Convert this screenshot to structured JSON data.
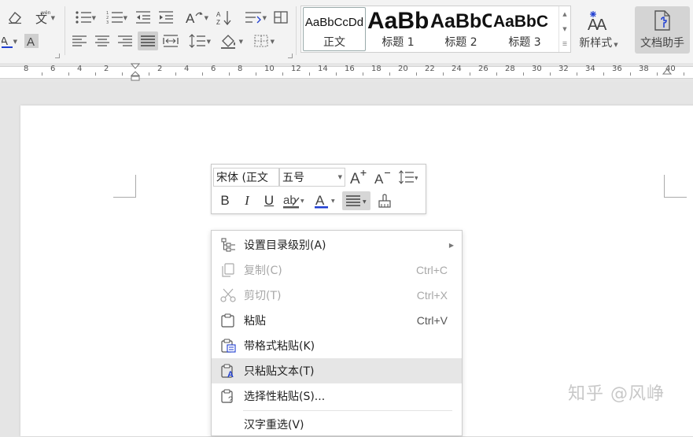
{
  "ribbon": {
    "styles": [
      {
        "sample": "AaBbCcDd",
        "name": "正文"
      },
      {
        "sample": "AaBb",
        "name": "标题 1"
      },
      {
        "sample": "AaBbC",
        "name": "标题 2"
      },
      {
        "sample": "AaBbC",
        "name": "标题 3"
      }
    ],
    "new_style_label": "新样式",
    "doc_assistant_label": "文档助手"
  },
  "ruler": {
    "left_labels": [
      "8",
      "6",
      "4",
      "2"
    ],
    "right_labels": [
      "2",
      "4",
      "6",
      "8",
      "10",
      "12",
      "14",
      "16",
      "18",
      "20",
      "22",
      "24",
      "26",
      "28",
      "30",
      "32",
      "34",
      "36",
      "38",
      "40"
    ]
  },
  "mini_toolbar": {
    "font_name": "宋体 (正文",
    "font_size": "五号",
    "font_color": "#1f3ed1"
  },
  "context_menu": {
    "items": [
      {
        "label": "设置目录级别(A)",
        "shortcut": "",
        "disabled": false,
        "submenu": true
      },
      {
        "label": "复制(C)",
        "shortcut": "Ctrl+C",
        "disabled": true
      },
      {
        "label": "剪切(T)",
        "shortcut": "Ctrl+X",
        "disabled": true
      },
      {
        "label": "粘贴",
        "shortcut": "Ctrl+V",
        "disabled": false
      },
      {
        "label": "带格式粘贴(K)",
        "shortcut": "",
        "disabled": false
      },
      {
        "label": "只粘贴文本(T)",
        "shortcut": "",
        "disabled": false,
        "hover": true
      },
      {
        "label": "选择性粘贴(S)...",
        "shortcut": "",
        "disabled": false
      },
      {
        "label": "汉字重选(V)",
        "shortcut": "",
        "disabled": false
      }
    ]
  },
  "watermark": "知乎 @风峥",
  "colors": {
    "accent_blue": "#1f3ed1",
    "menu_hover": "#e6e6e6",
    "disabled_text": "#a8a8a8"
  }
}
